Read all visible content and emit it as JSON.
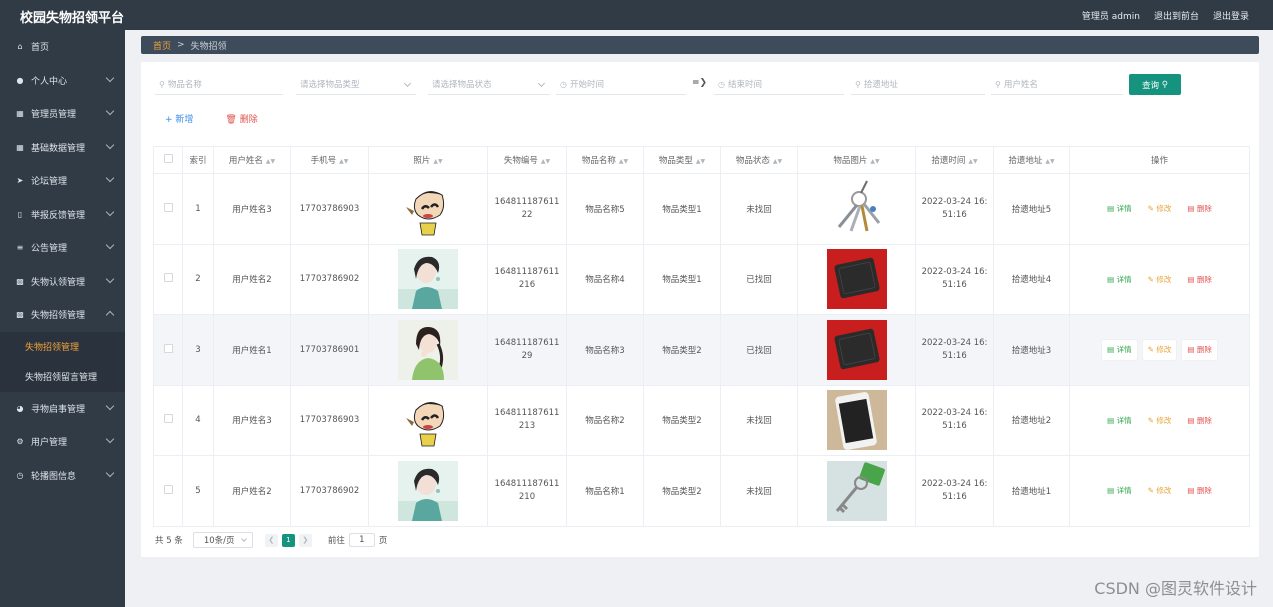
{
  "app": {
    "title": "校园失物招领平台"
  },
  "topbar": {
    "user": "管理员 admin",
    "front": "退出到前台",
    "logout": "退出登录"
  },
  "sidebar": {
    "items": [
      {
        "label": "首页",
        "icon": "home-icon",
        "has_sub": false
      },
      {
        "label": "个人中心",
        "icon": "user-icon",
        "has_sub": true
      },
      {
        "label": "管理员管理",
        "icon": "grid-icon",
        "has_sub": true
      },
      {
        "label": "基础数据管理",
        "icon": "apps-icon",
        "has_sub": true
      },
      {
        "label": "论坛管理",
        "icon": "send-icon",
        "has_sub": true
      },
      {
        "label": "举报反馈管理",
        "icon": "phone-icon",
        "has_sub": true
      },
      {
        "label": "公告管理",
        "icon": "sliders-icon",
        "has_sub": true
      },
      {
        "label": "失物认领管理",
        "icon": "monitor-icon",
        "has_sub": true
      },
      {
        "label": "失物招领管理",
        "icon": "message-icon",
        "has_sub": true,
        "open": true
      }
    ],
    "sub_items": [
      {
        "label": "失物招领管理",
        "active": true
      },
      {
        "label": "失物招领留言管理",
        "active": false
      }
    ],
    "items_after": [
      {
        "label": "寻物启事管理",
        "icon": "mic-icon",
        "has_sub": true
      },
      {
        "label": "用户管理",
        "icon": "gear-icon",
        "has_sub": true
      },
      {
        "label": "轮播图信息",
        "icon": "clock-icon",
        "has_sub": true
      }
    ]
  },
  "breadcrumb": {
    "home": "首页",
    "current": "失物招领"
  },
  "filters": {
    "name": "物品名称",
    "type": "请选择物品类型",
    "status": "请选择物品状态",
    "start": "开始时间",
    "end": "结束时间",
    "address": "拾遗地址",
    "user": "用户姓名",
    "query": "查询"
  },
  "actions": {
    "add": "新增",
    "delete": "删除"
  },
  "table": {
    "headers": [
      "索引",
      "用户姓名",
      "手机号",
      "照片",
      "失物编号",
      "物品名称",
      "物品类型",
      "物品状态",
      "物品图片",
      "拾遗时间",
      "拾遗地址",
      "操作"
    ],
    "rows": [
      {
        "index": "1",
        "user": "用户姓名3",
        "phone": "17703786903",
        "avatar": "cartoon",
        "code": "16481118761122",
        "item": "物品名称5",
        "type": "物品类型1",
        "status": "未找回",
        "pic": "keys",
        "time": "2022-03-24 16:51:16",
        "addr": "拾遗地址5"
      },
      {
        "index": "2",
        "user": "用户姓名2",
        "phone": "17703786902",
        "avatar": "woman-teal",
        "code": "164811187611216",
        "item": "物品名称4",
        "type": "物品类型1",
        "status": "已找回",
        "pic": "wallet",
        "time": "2022-03-24 16:51:16",
        "addr": "拾遗地址4"
      },
      {
        "index": "3",
        "user": "用户姓名1",
        "phone": "17703786901",
        "avatar": "woman-green",
        "code": "16481118761129",
        "item": "物品名称3",
        "type": "物品类型2",
        "status": "已找回",
        "pic": "wallet",
        "time": "2022-03-24 16:51:16",
        "addr": "拾遗地址3"
      },
      {
        "index": "4",
        "user": "用户姓名3",
        "phone": "17703786903",
        "avatar": "cartoon",
        "code": "164811187611213",
        "item": "物品名称2",
        "type": "物品类型2",
        "status": "未找回",
        "pic": "phone",
        "time": "2022-03-24 16:51:16",
        "addr": "拾遗地址2"
      },
      {
        "index": "5",
        "user": "用户姓名2",
        "phone": "17703786902",
        "avatar": "woman-teal",
        "code": "164811187611210",
        "item": "物品名称1",
        "type": "物品类型2",
        "status": "未找回",
        "pic": "key-tag",
        "time": "2022-03-24 16:51:16",
        "addr": "拾遗地址1"
      }
    ],
    "op_detail": "详情",
    "op_edit": "修改",
    "op_delete": "删除"
  },
  "pager": {
    "total": "共 5 条",
    "size": "10条/页",
    "page": "1",
    "goto": "前往",
    "goto_value": "1",
    "suffix": "页"
  },
  "watermark": "CSDN @图灵软件设计",
  "colors": {
    "accent": "#15937f",
    "sidebar": "#303b46",
    "active_menu": "#f0a33a",
    "danger": "#e0534f",
    "success": "#2fa34a",
    "warning": "#e9a43a"
  }
}
